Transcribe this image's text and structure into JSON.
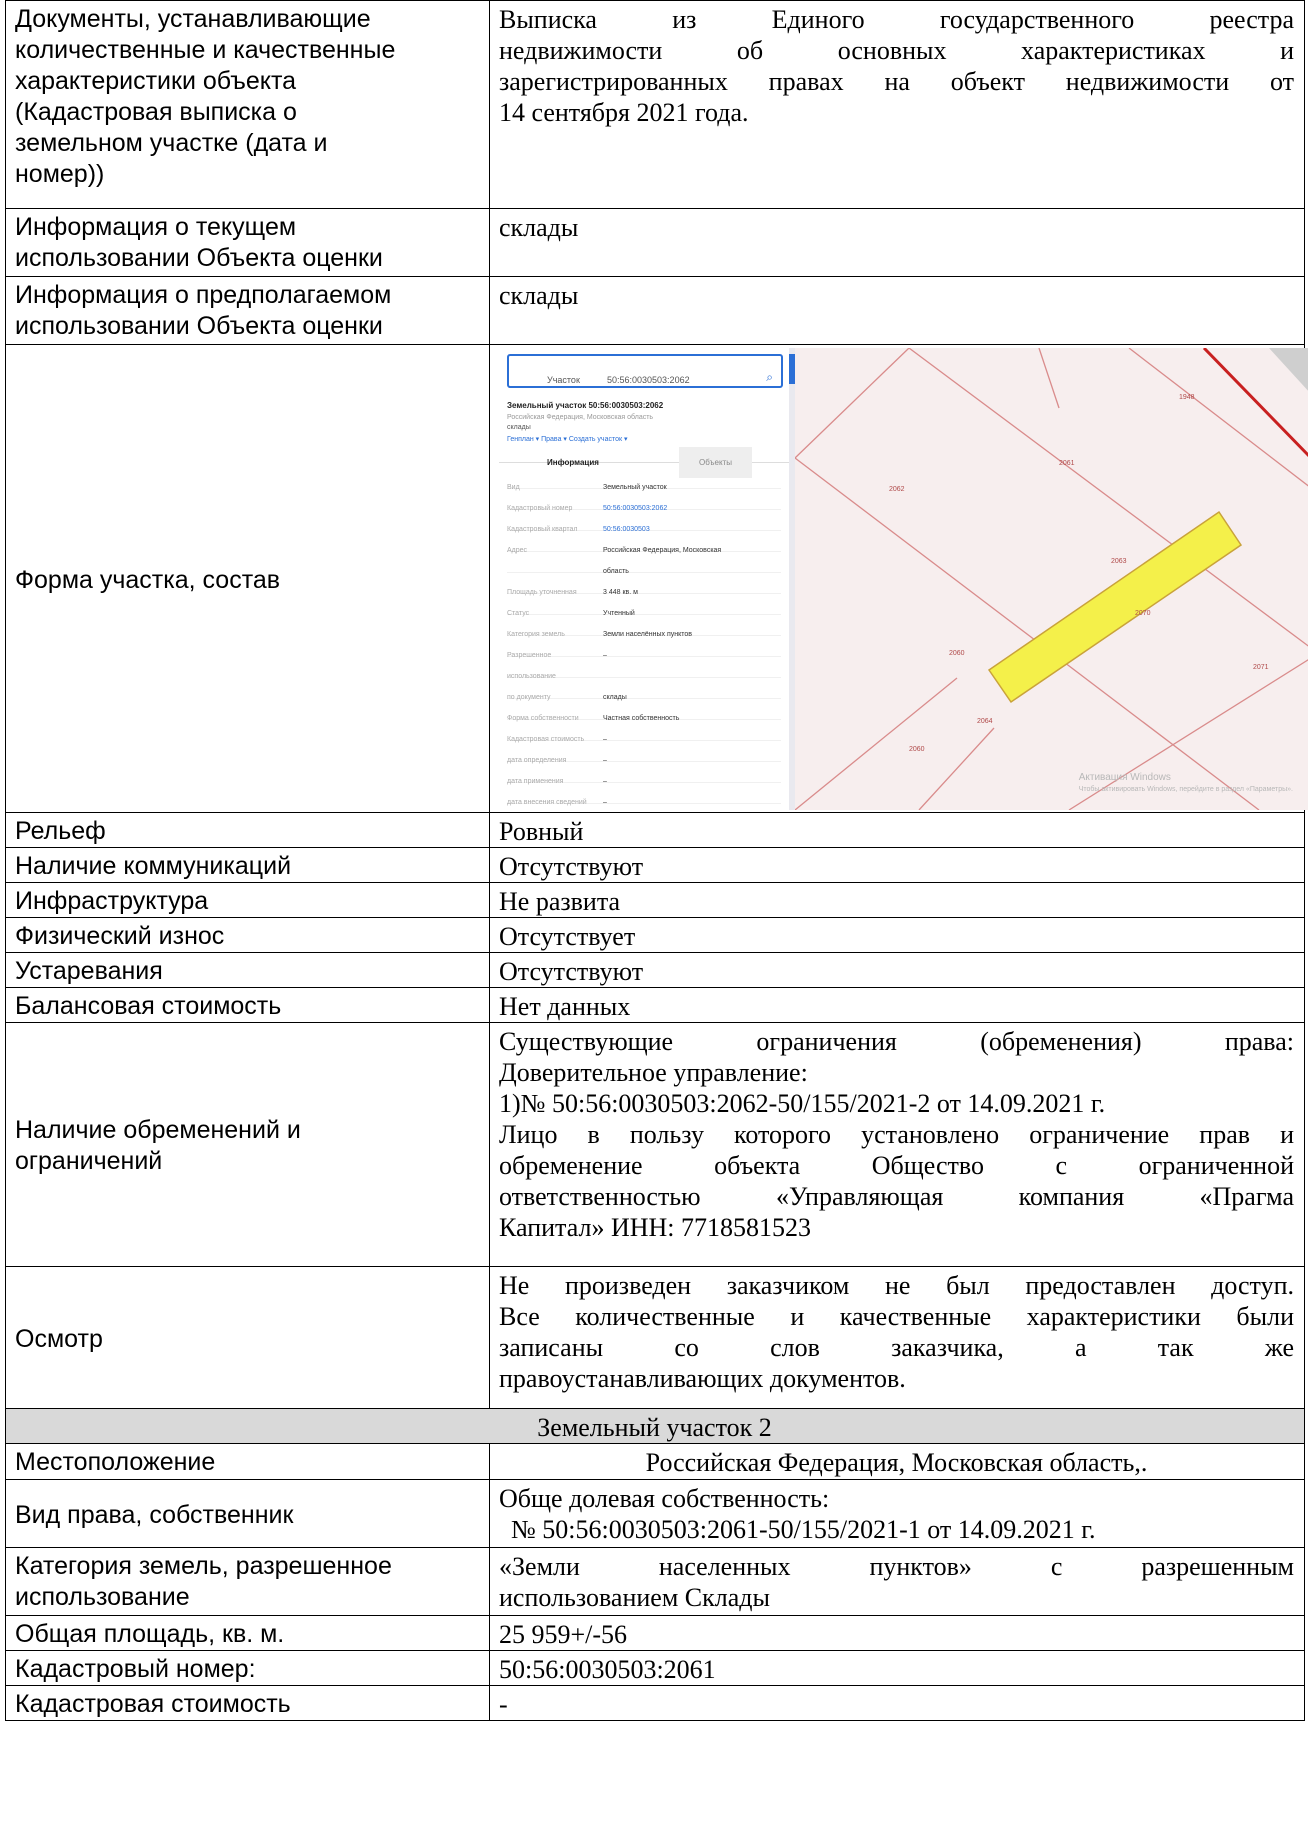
{
  "rows": {
    "docs": {
      "label": "Документы, устанавливающие количественные и качественные характеристики объекта (Кадастровая выписка о земельном участке (дата и номер))",
      "label_lines": [
        "Документы, устанавливающие",
        "количественные и качественные",
        "характеристики объекта",
        "(Кадастровая выписка о",
        "земельном участке (дата и",
        "номер))"
      ],
      "value_lines": [
        "Выписка из Единого государственного реестра",
        "недвижимости об основных характеристиках и",
        "зарегистрированных правах на объект недвижимости от"
      ],
      "value_last": "14 сентября 2021 года."
    },
    "current_use": {
      "label_lines": [
        "Информация о текущем",
        "использовании Объекта оценки"
      ],
      "value": "склады"
    },
    "planned_use": {
      "label_lines": [
        "Информация о предполагаемом",
        "использовании Объекта оценки"
      ],
      "value": "склады"
    },
    "shape": {
      "label": "Форма участка, состав",
      "map": {
        "search_type": "Участок",
        "search_value": "50:56:0030503:2062",
        "parcel_title": "Земельный участок 50:56:0030503:2062",
        "parcel_sub": "Российская Федерация, Московская область",
        "parcel_sub2": "склады",
        "links": "Генплан ▾   Права ▾   Создать участок ▾",
        "tab_info": "Информация",
        "tab_objects": "Объекты",
        "props": [
          {
            "k": "Вид",
            "v": "Земельный участок",
            "link": false
          },
          {
            "k": "Кадастровый номер",
            "v": "50:56:0030503:2062",
            "link": true
          },
          {
            "k": "Кадастровый квартал",
            "v": "50:56:0030503",
            "link": true
          },
          {
            "k": "Адрес",
            "v": "Российская Федерация, Московская",
            "link": false
          },
          {
            "k": "",
            "v": "область",
            "link": false
          },
          {
            "k": "Площадь уточненная",
            "v": "3 448 кв. м",
            "link": false
          },
          {
            "k": "Статус",
            "v": "Учтенный",
            "link": false
          },
          {
            "k": "Категория земель",
            "v": "Земли населённых пунктов",
            "link": false
          },
          {
            "k": "Разрешенное",
            "v": "–",
            "link": false
          },
          {
            "k": "использование",
            "v": "",
            "link": false
          },
          {
            "k": "по документу",
            "v": "склады",
            "link": false
          },
          {
            "k": "Форма собственности",
            "v": "Частная собственность",
            "link": false
          },
          {
            "k": "Кадастровая стоимость",
            "v": "–",
            "link": false
          },
          {
            "k": "дата определения",
            "v": "–",
            "link": false
          },
          {
            "k": "дата применения",
            "v": "–",
            "link": false
          },
          {
            "k": "дата внесения сведений",
            "v": "–",
            "link": false
          }
        ],
        "parcel_labels": [
          "1948",
          "2061",
          "2062",
          "2063",
          "2070",
          "2060",
          "2064",
          "2060",
          "2071"
        ],
        "watermark_1": "Активация Windows",
        "watermark_2": "Чтобы активировать Windows, перейдите в раздел «Параметры»."
      }
    },
    "relief": {
      "label": "Рельеф",
      "value": "Ровный"
    },
    "utilities": {
      "label": "Наличие коммуникаций",
      "value": "Отсутствуют"
    },
    "infrastructure": {
      "label": "Инфраструктура",
      "value": "Не развита"
    },
    "wear": {
      "label": "Физический износ",
      "value": "Отсутствует"
    },
    "obsolescence": {
      "label": "Устаревания",
      "value": "Отсутствуют"
    },
    "book_value": {
      "label": "Балансовая стоимость",
      "value": "Нет данных"
    },
    "encumbrances": {
      "label_lines": [
        "Наличие обременений и",
        "ограничений"
      ],
      "v1": "Существующие ограничения (обременения) права:",
      "v2": "Доверительное управление:",
      "v3": "1)№ 50:56:0030503:2062-50/155/2021-2 от 14.09.2021 г.",
      "v4_lines": [
        "Лицо в пользу которого установлено ограничение прав и",
        "обременение объекта Общество с ограниченной",
        "ответственностью «Управляющая компания «Прагма"
      ],
      "v4_last": "Капитал» ИНН: 7718581523"
    },
    "inspection": {
      "label": "Осмотр",
      "value_lines": [
        "Не произведен заказчиком не был предоставлен доступ.",
        "Все количественные и качественные характеристики были",
        "записаны со слов заказчика, а так же"
      ],
      "value_last": "правоустанавливающих документов."
    }
  },
  "section2": {
    "title": "Земельный участок 2",
    "location": {
      "label": "Местоположение",
      "value": "Российская Федерация, Московская область,."
    },
    "right": {
      "label": "Вид права, собственник",
      "v1": "Обще долевая собственность:",
      "v2": "№ 50:56:0030503:2061-50/155/2021-1 от 14.09.2021 г."
    },
    "category": {
      "label_lines": [
        "Категория земель, разрешенное",
        "использование"
      ],
      "value_line1": "«Земли населенных пунктов» с разрешенным",
      "value_line2": "использованием Склады"
    },
    "area": {
      "label": "Общая площадь, кв. м.",
      "value": "25 959+/-56"
    },
    "cadastral_no": {
      "label": "Кадастровый номер:",
      "value": "50:56:0030503:2061"
    },
    "cadastral_cost": {
      "label": "Кадастровая стоимость",
      "value": "-"
    }
  }
}
